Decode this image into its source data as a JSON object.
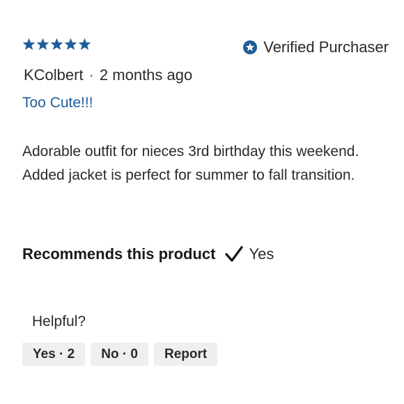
{
  "review": {
    "rating": 5,
    "rating_max": 5,
    "star_color": "#1f5c99",
    "verified_label": "Verified Purchaser",
    "reviewer": "KColbert",
    "separator": "·",
    "time_ago": "2 months ago",
    "title": "Too Cute!!!",
    "body": "Adorable outfit for nieces 3rd birthday this weekend. Added jacket is perfect for summer to fall transition.",
    "recommends_label": "Recommends this product",
    "recommends_value": "Yes"
  },
  "helpful": {
    "label": "Helpful?",
    "yes_label": "Yes · 2",
    "no_label": "No · 0",
    "report_label": "Report"
  },
  "icons": {
    "star": "star-icon",
    "verified": "verified-badge-icon",
    "check": "checkmark-icon"
  }
}
